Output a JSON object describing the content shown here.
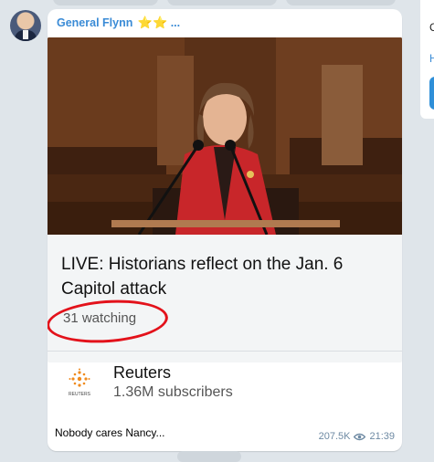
{
  "message": {
    "sender": "General Flynn",
    "sender_stars": "⭐⭐",
    "sender_suffix": "...",
    "caption": "Nobody cares Nancy...",
    "views": "207.5K",
    "time": "21:39",
    "link_preview": {
      "video_title": "LIVE: Historians reflect on the Jan. 6 Capitol attack",
      "watching": "31 watching",
      "channel_name": "Reuters",
      "channel_subscribers": "1.36M subscribers",
      "channel_logo_text": "REUTERS"
    }
  },
  "side_panel": {
    "text_c": "C",
    "link_h": "H"
  },
  "colors": {
    "accent": "#3a8bd6",
    "highlight_circle": "#e3121b",
    "background": "#dfe5ea"
  },
  "icons": [
    "avatar",
    "star-icon",
    "eye-icon",
    "reuters-logo"
  ]
}
